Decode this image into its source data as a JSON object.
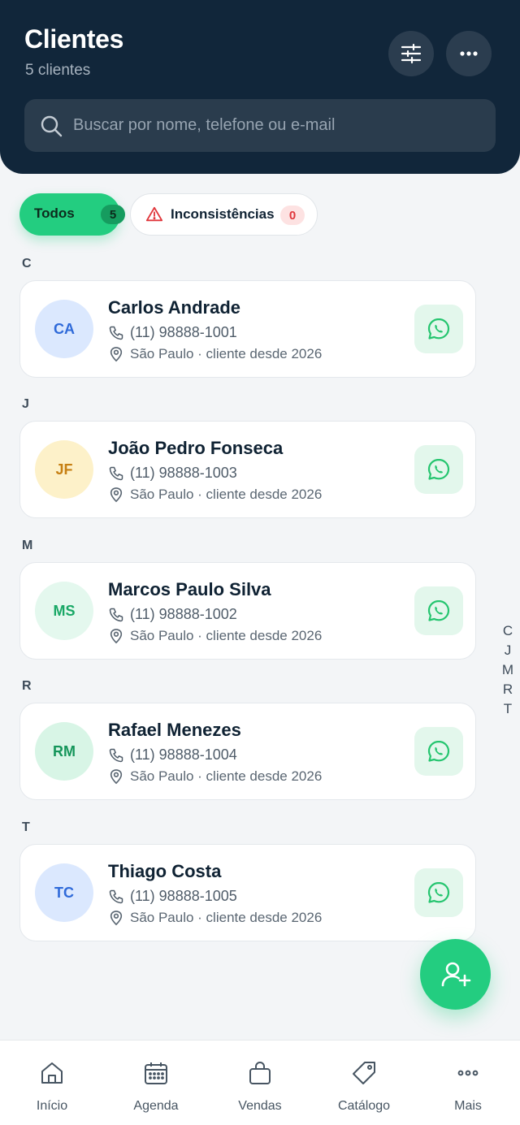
{
  "header": {
    "title": "Clientes",
    "subtitle": "5 clientes",
    "filter_icon": "sliders-icon",
    "more_icon": "more-horizontal-icon"
  },
  "search": {
    "placeholder": "Buscar por nome, telefone ou e-mail",
    "icon": "search-icon"
  },
  "chips": {
    "todos": {
      "label": "Todos",
      "count": "5"
    },
    "inconsistencias": {
      "label": "Inconsistências",
      "count": "0",
      "icon": "warning-triangle-icon"
    }
  },
  "sections": [
    {
      "letter": "C",
      "clients": [
        {
          "initials": "CA",
          "name": "Carlos Andrade",
          "phone": "(11) 98888-1001",
          "location": "São Paulo · cliente desde 2026",
          "avatar_bg": "#dbe8fe",
          "avatar_fg": "#2f6ad9"
        }
      ]
    },
    {
      "letter": "J",
      "clients": [
        {
          "initials": "JF",
          "name": "João Pedro Fonseca",
          "phone": "(11) 98888-1003",
          "location": "São Paulo · cliente desde 2026",
          "avatar_bg": "#fdf1c9",
          "avatar_fg": "#c67f12"
        }
      ]
    },
    {
      "letter": "M",
      "clients": [
        {
          "initials": "MS",
          "name": "Marcos Paulo Silva",
          "phone": "(11) 98888-1002",
          "location": "São Paulo · cliente desde 2026",
          "avatar_bg": "#e4f8ee",
          "avatar_fg": "#19a866"
        }
      ]
    },
    {
      "letter": "R",
      "clients": [
        {
          "initials": "RM",
          "name": "Rafael Menezes",
          "phone": "(11) 98888-1004",
          "location": "São Paulo · cliente desde 2026",
          "avatar_bg": "#d8f5e6",
          "avatar_fg": "#14955a"
        }
      ]
    },
    {
      "letter": "T",
      "clients": [
        {
          "initials": "TC",
          "name": "Thiago Costa",
          "phone": "(11) 98888-1005",
          "location": "São Paulo · cliente desde 2026",
          "avatar_bg": "#dbe8fe",
          "avatar_fg": "#2f6ad9"
        }
      ]
    }
  ],
  "alpha_index": [
    "C",
    "J",
    "M",
    "R",
    "T"
  ],
  "fab": {
    "icon": "add-user-icon"
  },
  "bottom_nav": [
    {
      "label": "Início",
      "icon": "home-icon"
    },
    {
      "label": "Agenda",
      "icon": "calendar-icon"
    },
    {
      "label": "Vendas",
      "icon": "shopping-bag-icon"
    },
    {
      "label": "Catálogo",
      "icon": "tag-icon"
    },
    {
      "label": "Mais",
      "icon": "more-horizontal-icon"
    }
  ],
  "colors": {
    "header_bg": "#11263a",
    "accent": "#23cd80",
    "whatsapp": "#25c56f",
    "danger": "#e0363b"
  }
}
